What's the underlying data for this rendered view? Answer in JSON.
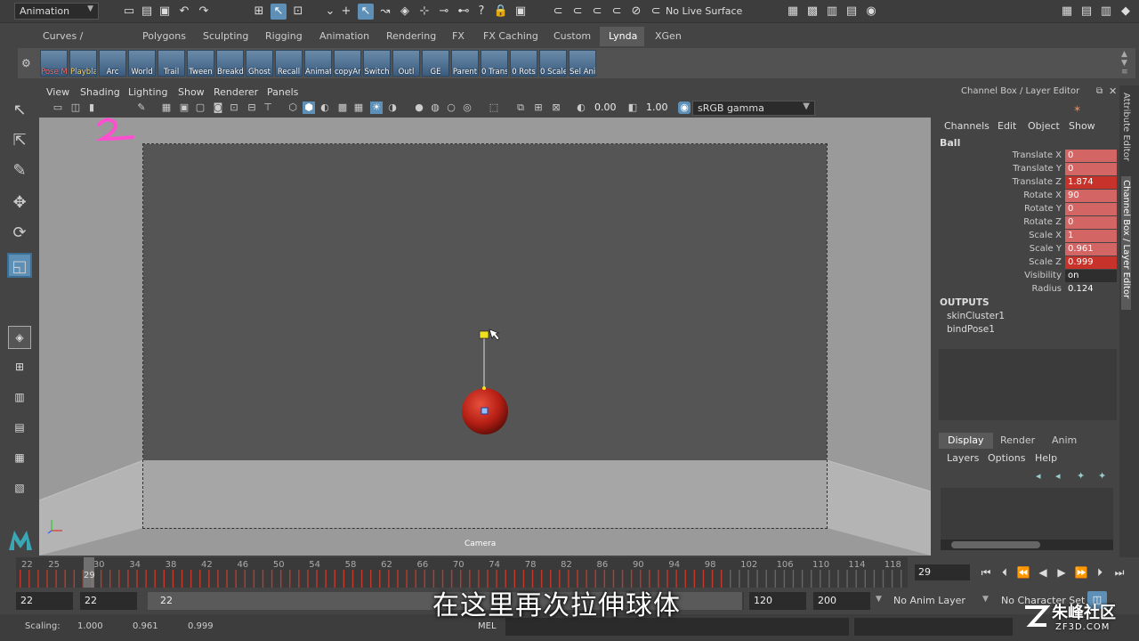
{
  "statusline": {
    "menuset": "Animation",
    "live_surface": "No Live Surface"
  },
  "shelf_tabs": [
    {
      "label": "Curves / Surfaces",
      "active": false
    },
    {
      "label": "Polygons",
      "active": false
    },
    {
      "label": "Sculpting",
      "active": false
    },
    {
      "label": "Rigging",
      "active": false
    },
    {
      "label": "Animation",
      "active": false
    },
    {
      "label": "Rendering",
      "active": false
    },
    {
      "label": "FX",
      "active": false
    },
    {
      "label": "FX Caching",
      "active": false
    },
    {
      "label": "Custom",
      "active": false
    },
    {
      "label": "Lynda",
      "active": true
    },
    {
      "label": "XGen",
      "active": false
    }
  ],
  "shelf_buttons": [
    {
      "label": "Pose M",
      "color": "red"
    },
    {
      "label": "Playbla",
      "color": "gold"
    },
    {
      "label": "Arc",
      "color": "white"
    },
    {
      "label": "World",
      "color": "white"
    },
    {
      "label": "Trail",
      "color": "white"
    },
    {
      "label": "Tween",
      "color": "white"
    },
    {
      "label": "Breakd",
      "color": "white"
    },
    {
      "label": "Ghost",
      "color": "white"
    },
    {
      "label": "Recall",
      "color": "white"
    },
    {
      "label": "Animat",
      "color": "white"
    },
    {
      "label": "copyAr",
      "color": "white"
    },
    {
      "label": "Switch",
      "color": "white"
    },
    {
      "label": "Outl",
      "color": "white"
    },
    {
      "label": "GE",
      "color": "white"
    },
    {
      "label": "Parent",
      "color": "white"
    },
    {
      "label": "0 Trans",
      "color": "white"
    },
    {
      "label": "0 Rots",
      "color": "white"
    },
    {
      "label": "0 Scale",
      "color": "white"
    },
    {
      "label": "Sel Ani",
      "color": "white"
    }
  ],
  "panel": {
    "menus": [
      "View",
      "Shading",
      "Lighting",
      "Show",
      "Renderer",
      "Panels"
    ],
    "exposure": "0.00",
    "gamma_value": "1.00",
    "colorspace": "sRGB gamma",
    "camera_label": "Camera"
  },
  "channel_box": {
    "title": "Channel Box / Layer Editor",
    "menus": [
      "Channels",
      "Edit",
      "Object",
      "Show"
    ],
    "object": "Ball",
    "channels": [
      {
        "label": "Translate X",
        "value": "0",
        "state": "key"
      },
      {
        "label": "Translate Y",
        "value": "0",
        "state": "key"
      },
      {
        "label": "Translate Z",
        "value": "1.874",
        "state": "key-hot"
      },
      {
        "label": "Rotate X",
        "value": "90",
        "state": "key"
      },
      {
        "label": "Rotate Y",
        "value": "0",
        "state": "key"
      },
      {
        "label": "Rotate Z",
        "value": "0",
        "state": "key"
      },
      {
        "label": "Scale X",
        "value": "1",
        "state": "key"
      },
      {
        "label": "Scale Y",
        "value": "0.961",
        "state": "key"
      },
      {
        "label": "Scale Z",
        "value": "0.999",
        "state": "key-hot"
      },
      {
        "label": "Visibility",
        "value": "on",
        "state": "plain"
      },
      {
        "label": "Radius",
        "value": "0.124",
        "state": "none"
      }
    ],
    "outputs_header": "OUTPUTS",
    "outputs": [
      "skinCluster1",
      "bindPose1"
    ]
  },
  "side_tabs": [
    "Attribute Editor",
    "Channel Box / Layer Editor"
  ],
  "layer_editor": {
    "tabs": [
      {
        "label": "Display",
        "active": true
      },
      {
        "label": "Render",
        "active": false
      },
      {
        "label": "Anim",
        "active": false
      }
    ],
    "menus": [
      "Layers",
      "Options",
      "Help"
    ]
  },
  "timeslider": {
    "ticks": [
      "22",
      "25",
      "30",
      "34",
      "38",
      "42",
      "46",
      "50",
      "54",
      "58",
      "62",
      "66",
      "70",
      "74",
      "78",
      "82",
      "86",
      "90",
      "94",
      "98",
      "102",
      "106",
      "110",
      "114",
      "118"
    ],
    "current_frame": "29",
    "current_field": "29"
  },
  "range": {
    "start": "22",
    "playback_start": "22",
    "slider_start": "22",
    "playback_end": "120",
    "end": "200",
    "anim_layer": "No Anim Layer",
    "character_set": "No Character Set"
  },
  "command_line": {
    "scaling_label": "Scaling:",
    "scaling_x": "1.000",
    "scaling_y": "0.961",
    "scaling_z": "0.999",
    "mel_label": "MEL"
  },
  "overlay": {
    "subtitle": "在这里再次拉伸球体",
    "watermark_name": "朱峰社区",
    "watermark_site": "ZF3D.COM"
  },
  "colors": {
    "accent_blue": "#5d8fb7",
    "key_red": "#d46565",
    "key_hot_red": "#c7332b",
    "ball_red": "#c0271c",
    "locator_yellow": "#f0e020"
  }
}
